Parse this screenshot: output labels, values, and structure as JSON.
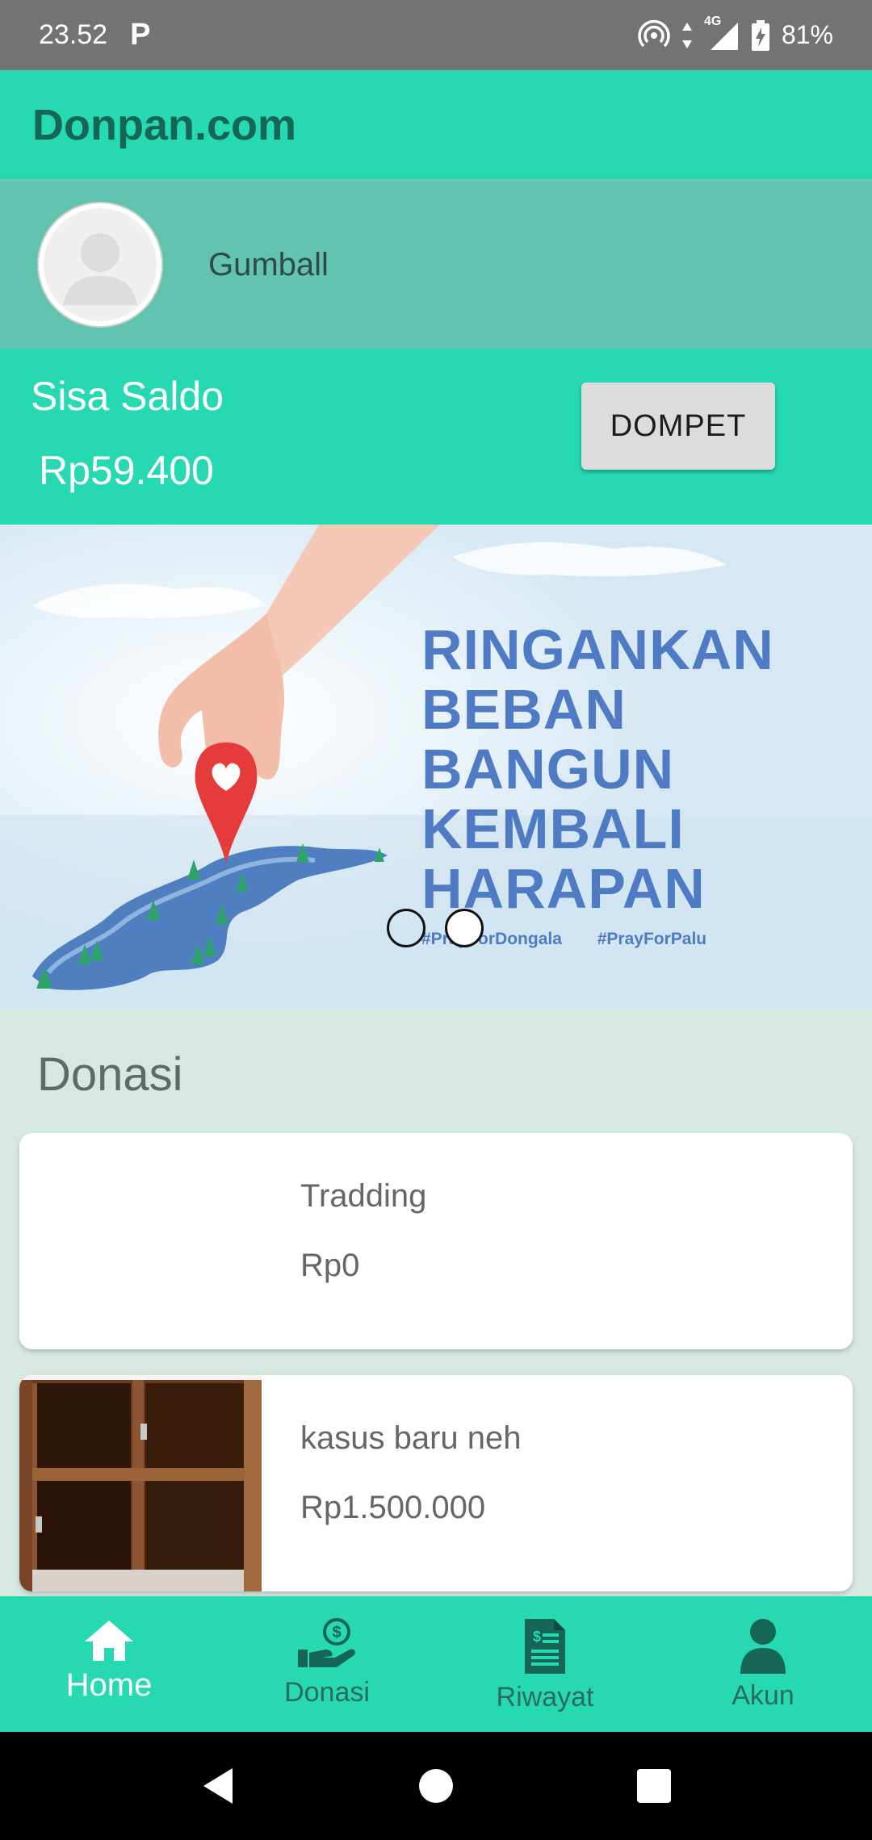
{
  "status_bar": {
    "time": "23.52",
    "app_indicator": "P",
    "network": "4G",
    "battery": "81%"
  },
  "app_bar": {
    "title": "Donpan.com"
  },
  "profile": {
    "name": "Gumball",
    "avatar_icon": "default-avatar-icon"
  },
  "balance": {
    "label": "Sisa Saldo",
    "value": "Rp59.400",
    "wallet_button": "DOMPET"
  },
  "banner": {
    "headline": [
      "RINGANKAN",
      "BEBAN",
      "BANGUN",
      "KEMBALI",
      "HARAPAN"
    ],
    "hashtags": [
      "#PrayForDongala",
      "#PrayForPalu"
    ],
    "slide_count": 2,
    "active_slide": 2
  },
  "donations": {
    "title": "Donasi",
    "items": [
      {
        "title": "Tradding",
        "amount": "Rp0"
      },
      {
        "title": "kasus baru neh",
        "amount": "Rp1.500.000"
      }
    ]
  },
  "bottom_nav": {
    "items": [
      {
        "label": "Home",
        "icon": "home-icon",
        "active": true
      },
      {
        "label": "Donasi",
        "icon": "donate-hand-icon",
        "active": false
      },
      {
        "label": "Riwayat",
        "icon": "receipt-icon",
        "active": false
      },
      {
        "label": "Akun",
        "icon": "person-icon",
        "active": false
      }
    ]
  },
  "colors": {
    "primary": "#26d9b3",
    "primary_dark": "#156655",
    "profile_bg": "#62c4ae",
    "page_bg": "#d6e8e0",
    "banner_text": "#4f7bc4"
  }
}
